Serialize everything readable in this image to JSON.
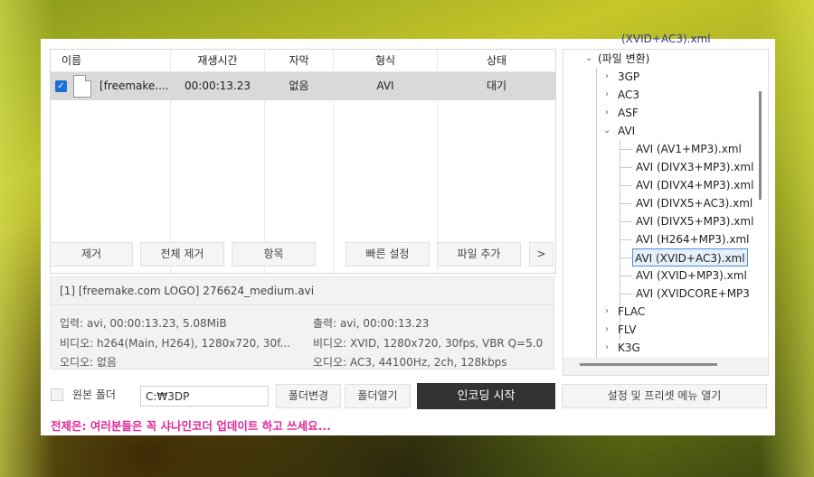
{
  "table": {
    "headers": [
      "이름",
      "재생시간",
      "자막",
      "형식",
      "상태"
    ],
    "rows": [
      {
        "checked": true,
        "name": "[freemake....",
        "duration": "00:00:13.23",
        "subtitle": "없음",
        "format": "AVI",
        "status": "대기"
      }
    ]
  },
  "buttons": {
    "remove": "제거",
    "remove_all": "전체 제거",
    "item": "항목",
    "quick_settings": "빠른 설정",
    "add_file": "파일 추가",
    "more": ">"
  },
  "info": {
    "title": "[1]  [freemake.com LOGO]  276624_medium.avi",
    "input": "입력: avi, 00:00:13.23, 5.08MiB",
    "video_in": "비디오: h264(Main, H264), 1280x720, 30f...",
    "audio_in": "오디오: 없음",
    "output": "출력: avi, 00:00:13.23",
    "video_out": "비디오: XVID, 1280x720, 30fps, VBR Q=5.0",
    "audio_out": "오디오: AC3, 44100Hz, 2ch, 128kbps"
  },
  "tree": {
    "overflow_label": "(XVID+AC3).xml",
    "root": "(파일 변환)",
    "items": [
      {
        "label": "3GP",
        "expanded": false
      },
      {
        "label": "AC3",
        "expanded": false
      },
      {
        "label": "ASF",
        "expanded": false
      },
      {
        "label": "AVI",
        "expanded": true
      },
      {
        "label": "FLAC",
        "expanded": false
      },
      {
        "label": "FLV",
        "expanded": false
      },
      {
        "label": "K3G",
        "expanded": false
      }
    ],
    "avi_children": [
      "AVI (AV1+MP3).xml",
      "AVI (DIVX3+MP3).xml",
      "AVI (DIVX4+MP3).xml",
      "AVI (DIVX5+AC3).xml",
      "AVI (DIVX5+MP3).xml",
      "AVI (H264+MP3).xml",
      "AVI (XVID+AC3).xml",
      "AVI (XVID+MP3).xml",
      "AVI (XVIDCORE+MP3"
    ],
    "selected": "AVI (XVID+AC3).xml"
  },
  "bottom": {
    "source_folder_label": "원본 폴더",
    "path_value": "C:₩3DP",
    "change_folder": "폴더변경",
    "open_folder": "폴더열기",
    "start_encoding": "인코딩 시작",
    "preset_menu": "설정 및 프리셋 메뉴 열기"
  },
  "notice": "전제은: 여러분들은 꼭 샤나인코더 업데이트 하고 쓰세요...",
  "colors": {
    "accent_blue": "#1a6fd8",
    "notice_pink": "#e0289a",
    "start_button": "#333333"
  }
}
